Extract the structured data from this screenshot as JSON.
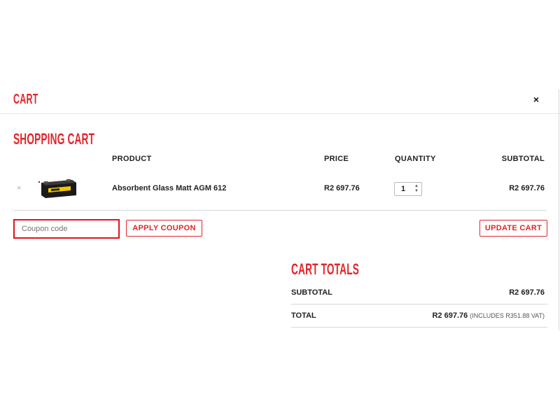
{
  "header": {
    "title": "CART",
    "close_label": "×"
  },
  "cart": {
    "section_title": "SHOPPING CART",
    "columns": {
      "product": "PRODUCT",
      "price": "PRICE",
      "quantity": "QUANTITY",
      "subtotal": "SUBTOTAL"
    },
    "items": [
      {
        "remove_label": "×",
        "image_icon": "battery-product-image",
        "name": "Absorbent Glass Matt AGM 612",
        "price": "R2 697.76",
        "quantity": "1",
        "subtotal": "R2 697.76"
      }
    ],
    "coupon_placeholder": "Coupon code",
    "apply_coupon_label": "APPLY COUPON",
    "update_cart_label": "UPDATE CART"
  },
  "totals": {
    "title": "CART TOTALS",
    "subtotal_label": "SUBTOTAL",
    "subtotal_value": "R2 697.76",
    "total_label": "TOTAL",
    "total_value": "R2 697.76",
    "total_note": "(INCLUDES R351.88 VAT)"
  },
  "colors": {
    "accent": "#e1252a",
    "focus_border": "#e1121c"
  }
}
